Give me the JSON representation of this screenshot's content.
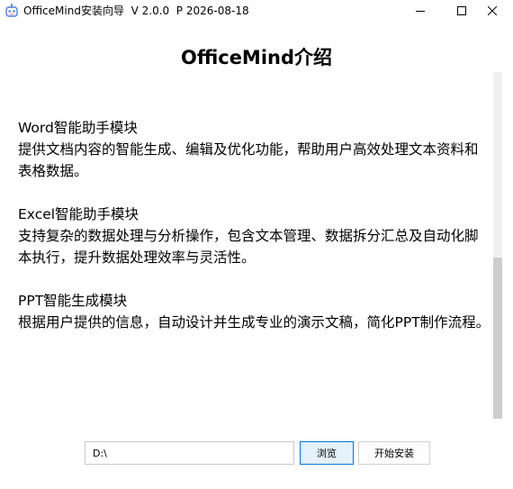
{
  "window": {
    "app_name": "OfficeMind安装向导",
    "version": "V 2.0.0",
    "date": "P 2026-08-18"
  },
  "heading": "OfficeMind介绍",
  "sections": [
    {
      "title": "Word智能助手模块",
      "desc": "提供文档内容的智能生成、编辑及优化功能，帮助用户高效处理文本资料和表格数据。"
    },
    {
      "title": "Excel智能助手模块",
      "desc": "支持复杂的数据处理与分析操作，包含文本管理、数据拆分汇总及自动化脚本执行，提升数据处理效率与灵活性。"
    },
    {
      "title": "PPT智能生成模块",
      "desc": "根据用户提供的信息，自动设计并生成专业的演示文稿，简化PPT制作流程。"
    }
  ],
  "install_path": {
    "value": "D:\\",
    "placeholder": ""
  },
  "buttons": {
    "browse": "浏览",
    "install": "开始安装"
  },
  "colors": {
    "accent": "#0078d7",
    "browse_bg": "#e5f1fb"
  }
}
